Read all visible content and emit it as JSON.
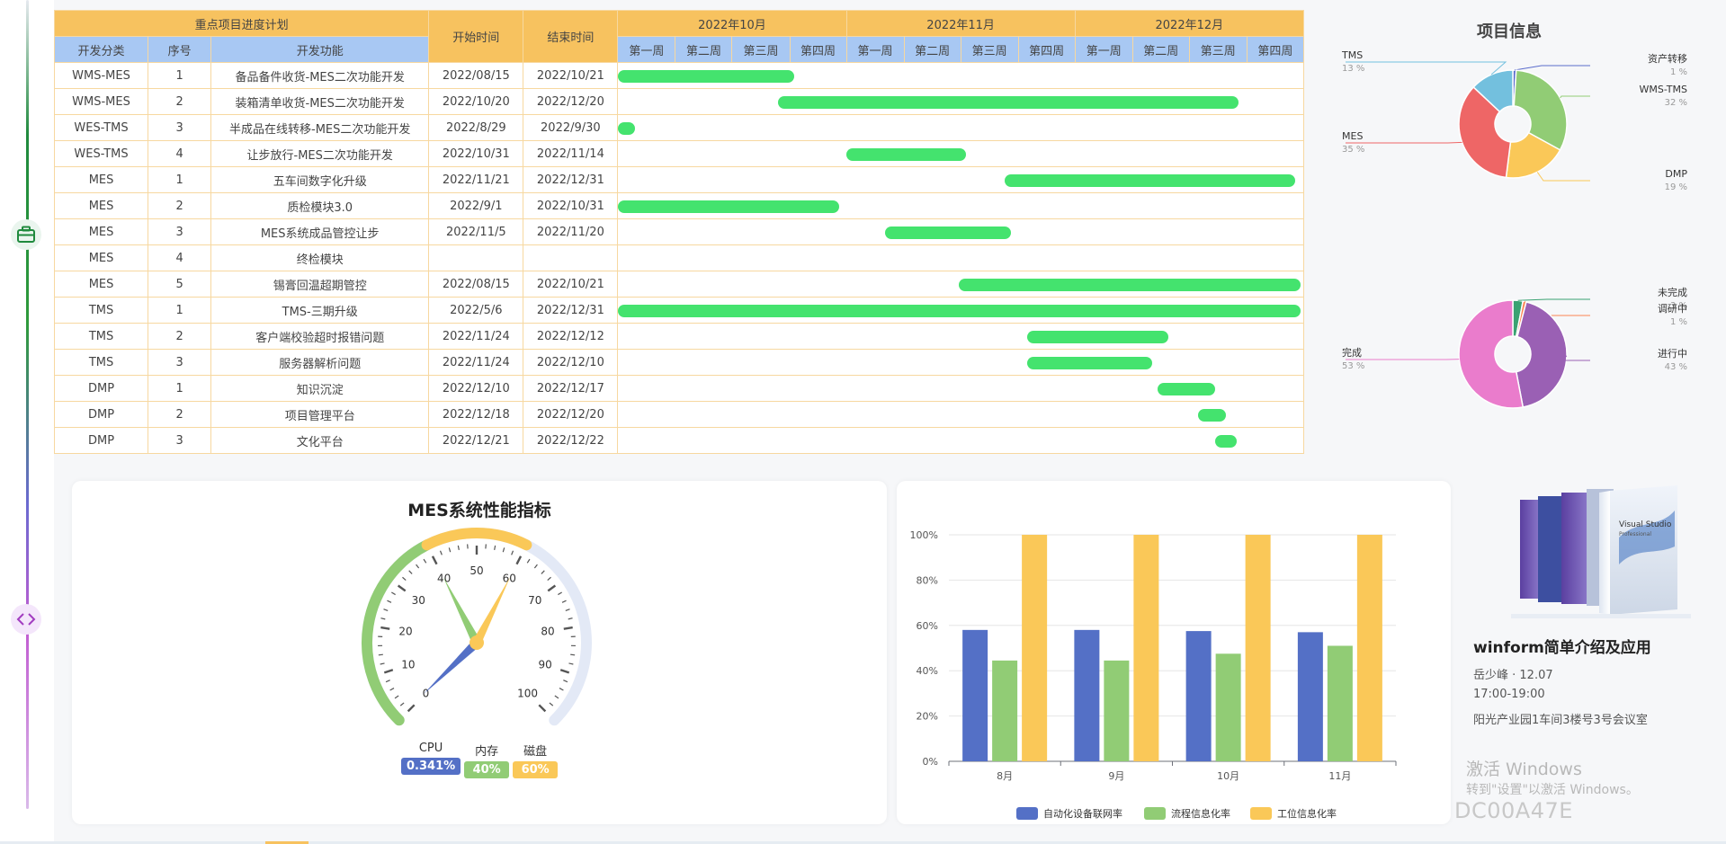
{
  "gantt": {
    "group_header": "重点项目进度计划",
    "col_category": "开发分类",
    "col_seq": "序号",
    "col_feature": "开发功能",
    "col_start": "开始时间",
    "col_end": "结束时间",
    "months": [
      "2022年10月",
      "2022年11月",
      "2022年12月"
    ],
    "weeks": [
      "第一周",
      "第二周",
      "第三周",
      "第四周",
      "第一周",
      "第二周",
      "第三周",
      "第四周",
      "第一周",
      "第二周",
      "第三周",
      "第四周"
    ],
    "bar_color": "#44e36e",
    "rows": [
      {
        "cat": "WMS-MES",
        "seq": "1",
        "feature": "备品备件收货-MES二次功能开发",
        "start": "2022/08/15",
        "end": "2022/10/21",
        "bar": [
          0.0,
          0.257
        ]
      },
      {
        "cat": "WMS-MES",
        "seq": "2",
        "feature": "装箱清单收货-MES二次功能开发",
        "start": "2022/10/20",
        "end": "2022/12/20",
        "bar": [
          0.233,
          0.906
        ]
      },
      {
        "cat": "WES-TMS",
        "seq": "3",
        "feature": "半成品在线转移-MES二次功能开发",
        "start": "2022/8/29",
        "end": "2022/9/30",
        "bar": [
          0.0,
          0.025
        ]
      },
      {
        "cat": "WES-TMS",
        "seq": "4",
        "feature": "让步放行-MES二次功能开发",
        "start": "2022/10/31",
        "end": "2022/11/14",
        "bar": [
          0.333,
          0.507
        ]
      },
      {
        "cat": "MES",
        "seq": "1",
        "feature": "五车间数字化升级",
        "start": "2022/11/21",
        "end": "2022/12/31",
        "bar": [
          0.564,
          0.988
        ]
      },
      {
        "cat": "MES",
        "seq": "2",
        "feature": "质检模块3.0",
        "start": "2022/9/1",
        "end": "2022/10/31",
        "bar": [
          0.0,
          0.323
        ]
      },
      {
        "cat": "MES",
        "seq": "3",
        "feature": "MES系统成品管控让步",
        "start": "2022/11/5",
        "end": "2022/11/20",
        "bar": [
          0.389,
          0.573
        ]
      },
      {
        "cat": "MES",
        "seq": "4",
        "feature": "终检模块",
        "start": "",
        "end": "",
        "bar": null
      },
      {
        "cat": "MES",
        "seq": "5",
        "feature": "锡膏回温超期管控",
        "start": "2022/08/15",
        "end": "2022/10/21",
        "bar": [
          0.497,
          0.996
        ]
      },
      {
        "cat": "TMS",
        "seq": "1",
        "feature": "TMS-三期升级",
        "start": "2022/5/6",
        "end": "2022/12/31",
        "bar": [
          0.0,
          0.996
        ]
      },
      {
        "cat": "TMS",
        "seq": "2",
        "feature": "客户端校验超时报错问题",
        "start": "2022/11/24",
        "end": "2022/12/12",
        "bar": [
          0.597,
          0.803
        ]
      },
      {
        "cat": "TMS",
        "seq": "3",
        "feature": "服务器解析问题",
        "start": "2022/11/24",
        "end": "2022/12/10",
        "bar": [
          0.597,
          0.779
        ]
      },
      {
        "cat": "DMP",
        "seq": "1",
        "feature": "知识沉淀",
        "start": "2022/12/10",
        "end": "2022/12/17",
        "bar": [
          0.787,
          0.871
        ]
      },
      {
        "cat": "DMP",
        "seq": "2",
        "feature": "项目管理平台",
        "start": "2022/12/18",
        "end": "2022/12/20",
        "bar": [
          0.846,
          0.887
        ]
      },
      {
        "cat": "DMP",
        "seq": "3",
        "feature": "文化平台",
        "start": "2022/12/21",
        "end": "2022/12/22",
        "bar": [
          0.871,
          0.903
        ]
      }
    ]
  },
  "project_info": {
    "title": "项目信息",
    "pie1": [
      {
        "name": "资产转移",
        "pct": "1 %",
        "value": 1,
        "color": "#5b6ccc"
      },
      {
        "name": "WMS-TMS",
        "pct": "32 %",
        "value": 32,
        "color": "#91cc75"
      },
      {
        "name": "DMP",
        "pct": "19 %",
        "value": 19,
        "color": "#fac858"
      },
      {
        "name": "MES",
        "pct": "35 %",
        "value": 35,
        "color": "#ee6666"
      },
      {
        "name": "TMS",
        "pct": "13 %",
        "value": 13,
        "color": "#73c0de"
      }
    ],
    "pie2": [
      {
        "name": "未完成",
        "pct": "3 %",
        "value": 3,
        "color": "#3ba272"
      },
      {
        "name": "调研中",
        "pct": "1 %",
        "value": 1,
        "color": "#fc8452"
      },
      {
        "name": "进行中",
        "pct": "43 %",
        "value": 43,
        "color": "#9a60b4"
      },
      {
        "name": "完成",
        "pct": "53 %",
        "value": 53,
        "color": "#ea7ccc"
      }
    ]
  },
  "gauge": {
    "title": "MES系统性能指标",
    "ticks": [
      "0",
      "10",
      "20",
      "30",
      "40",
      "50",
      "60",
      "70",
      "80",
      "90",
      "100"
    ],
    "metrics": [
      {
        "name": "CPU",
        "value": "0.341%",
        "num": 0.341,
        "color": "#5470c6"
      },
      {
        "name": "内存",
        "value": "40%",
        "num": 40,
        "color": "#91cc75"
      },
      {
        "name": "磁盘",
        "value": "60%",
        "num": 60,
        "color": "#fac858"
      }
    ]
  },
  "chart_data": {
    "type": "bar",
    "categories": [
      "8月",
      "9月",
      "10月",
      "11月"
    ],
    "series": [
      {
        "name": "自动化设备联网率",
        "values": [
          58,
          58,
          57.5,
          57
        ],
        "color": "#5470c6"
      },
      {
        "name": "流程信息化率",
        "values": [
          44.5,
          44.5,
          47.5,
          51
        ],
        "color": "#91cc75"
      },
      {
        "name": "工位信息化率",
        "values": [
          100,
          100,
          100,
          100
        ],
        "color": "#fac858"
      }
    ],
    "ylim": [
      0,
      100
    ],
    "yticks": [
      "0%",
      "20%",
      "40%",
      "60%",
      "80%",
      "100%"
    ],
    "legend_position": "bottom"
  },
  "event": {
    "title": "winform简单介绍及应用",
    "host_date": "岳少峰 · 12.07",
    "time": "17:00-19:00",
    "location": "阳光产业园1车间3楼号3号会议室",
    "product_lines": [
      "Visual Studio",
      "Professional"
    ]
  },
  "watermark": {
    "line1": "激活 Windows",
    "line2": "转到\"设置\"以激活 Windows。",
    "device_id": "DC00A47E"
  }
}
